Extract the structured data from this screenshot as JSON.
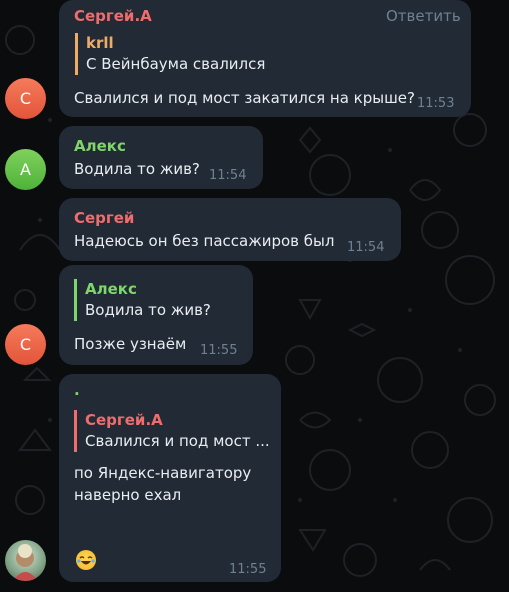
{
  "messages": [
    {
      "sender": "Сергей.А",
      "reply_action": "Ответить",
      "quote_author": "krll",
      "quote_text": "С Вейнбаума свалился",
      "text": "Свалился и под мост закатился на крыше?",
      "time": "11:53",
      "avatar_letter": "С"
    },
    {
      "sender": "Алекс",
      "text": "Водила то жив?",
      "time": "11:54",
      "avatar_letter": "А"
    },
    {
      "sender": "Сергей",
      "text": "Надеюсь он без пассажиров был",
      "time": "11:54"
    },
    {
      "quote_author": "Алекс",
      "quote_text": "Водила то жив?",
      "text": "Позже узнаём",
      "time": "11:55",
      "avatar_letter": "С"
    },
    {
      "sender": ".",
      "quote_author": "Сергей.А",
      "quote_text": "Свалился и под мост ...",
      "text_line1": "по Яндекс-навигатору",
      "text_line2": "наверно ехал",
      "emoji": "laughing-emoji",
      "time": "11:55"
    }
  ],
  "colors": {
    "bubble": "#212a35",
    "background": "#0b0c0e",
    "name_red": "#ef6d6d",
    "name_green": "#7fd66a",
    "name_orange": "#ecab66",
    "timestamp": "#6f8090"
  }
}
